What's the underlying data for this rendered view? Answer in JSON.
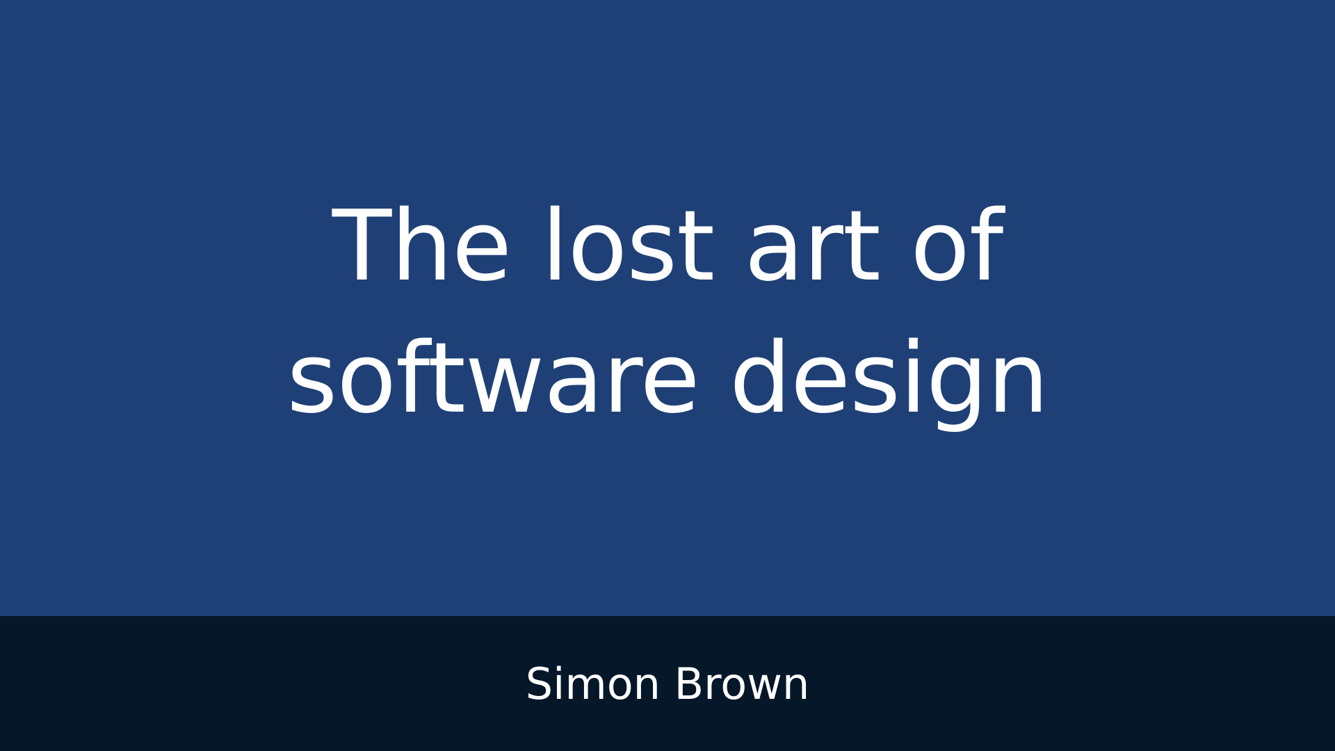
{
  "slide": {
    "title": "The lost art of software design",
    "author": "Simon Brown"
  },
  "colors": {
    "main_background": "#1e4076",
    "footer_background": "#06172a",
    "text": "#ffffff"
  }
}
